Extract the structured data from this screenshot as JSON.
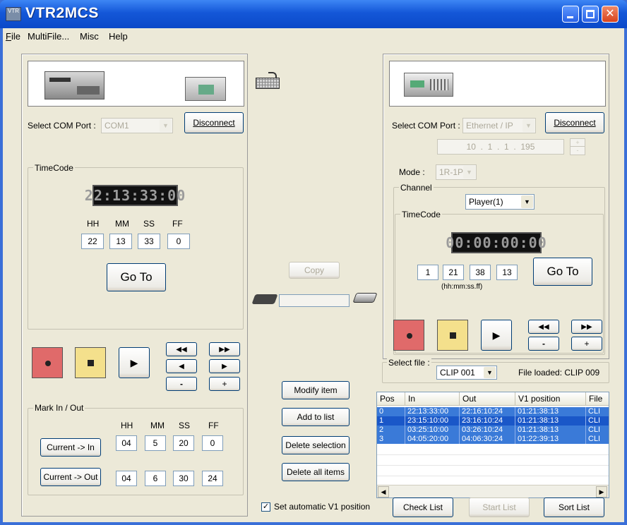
{
  "window": {
    "title": "VTR2MCS",
    "icon_text": "VTR"
  },
  "menu": [
    {
      "label": "File"
    },
    {
      "label": "MultiFile..."
    },
    {
      "label": "Misc"
    },
    {
      "label": "Help"
    }
  ],
  "left": {
    "com_label": "Select COM Port :",
    "com_value": "COM1",
    "disconnect": "Disconnect",
    "timecode_title": "TimeCode",
    "lcd": "22:13:33:00",
    "hh_label": "HH",
    "mm_label": "MM",
    "ss_label": "SS",
    "ff_label": "FF",
    "hh": "22",
    "mm": "13",
    "ss": "33",
    "ff": "0",
    "goto": "Go To",
    "mark_title": "Mark In / Out",
    "in": {
      "hh": "04",
      "mm": "5",
      "ss": "20",
      "ff": "0"
    },
    "out": {
      "hh": "04",
      "mm": "6",
      "ss": "30",
      "ff": "24"
    },
    "current_in": "Current -> In",
    "current_out": "Current -> Out",
    "minus": "-",
    "plus": "+"
  },
  "middle": {
    "copy": "Copy",
    "modify": "Modify item",
    "add": "Add to list",
    "delete_sel": "Delete selection",
    "delete_all": "Delete all items",
    "auto_v1": "Set automatic V1 position",
    "auto_v1_checked": "✓"
  },
  "right": {
    "com_label": "Select COM Port :",
    "com_value": "Ethernet / IP",
    "disconnect": "Disconnect",
    "ip": [
      "10",
      "1",
      "1",
      "195"
    ],
    "ip_dot": ".",
    "mode_label": "Mode :",
    "mode_value": "1R-1P",
    "channel_title": "Channel",
    "channel_value": "Player(1)",
    "timecode_title": "TimeCode",
    "lcd": "00:00:00:00",
    "h": "1",
    "m": "21",
    "s": "38",
    "f": "13",
    "format": "(hh:mm:ss.ff)",
    "goto": "Go To",
    "minus": "-",
    "plus": "+",
    "select_file_title": "Select file :",
    "file_value": "CLIP 001",
    "file_loaded": "File loaded: CLIP 009",
    "columns": [
      "Pos",
      "In",
      "Out",
      "V1 position",
      "File"
    ],
    "rows": [
      [
        "0",
        "22:13:33:00",
        "22:16:10:24",
        "01:21:38:13",
        "CLI"
      ],
      [
        "1",
        "23:15:10:00",
        "23:16:10:24",
        "01:21:38:13",
        "CLI"
      ],
      [
        "2",
        "03:25:10:00",
        "03:26:10:24",
        "01:21:38:13",
        "CLI"
      ],
      [
        "3",
        "04:05:20:00",
        "04:06:30:24",
        "01:22:39:13",
        "CLI"
      ]
    ],
    "check_list": "Check List",
    "start_list": "Start List",
    "sort_list": "Sort List"
  },
  "colors": {
    "titlebar": "#0b49c8",
    "record": "#e06a6a",
    "stop": "#f4e08c",
    "selection": "#3a7ad8"
  }
}
